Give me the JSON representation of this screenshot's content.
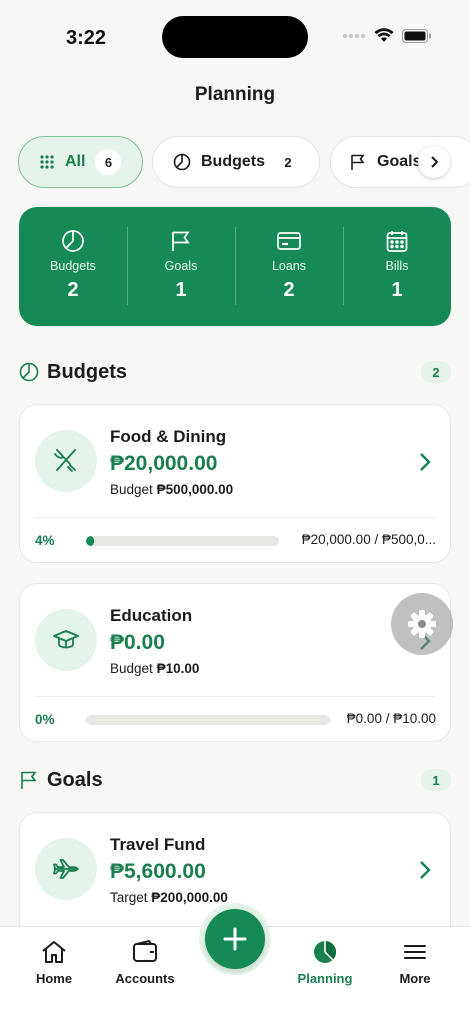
{
  "status_bar": {
    "time": "3:22"
  },
  "header": {
    "title": "Planning"
  },
  "filter_chips": [
    {
      "label": "All",
      "count": "6",
      "icon": "grid-icon",
      "active": true
    },
    {
      "label": "Budgets",
      "count": "2",
      "icon": "pie-chart-icon",
      "active": false
    },
    {
      "label": "Goals",
      "count": "",
      "icon": "flag-icon",
      "active": false
    }
  ],
  "summary": [
    {
      "label": "Budgets",
      "value": "2",
      "icon": "pie-chart-icon"
    },
    {
      "label": "Goals",
      "value": "1",
      "icon": "flag-icon"
    },
    {
      "label": "Loans",
      "value": "2",
      "icon": "card-icon"
    },
    {
      "label": "Bills",
      "value": "1",
      "icon": "calendar-icon"
    }
  ],
  "budgets_section": {
    "title": "Budgets",
    "count": "2",
    "items": [
      {
        "name": "Food & Dining",
        "amount": "₱20,000.00",
        "sub_label": "Budget",
        "sub_value": "₱500,000.00",
        "percent_label": "4%",
        "progress": 0.04,
        "ratio": "₱20,000.00 / ₱500,0...",
        "icon": "fork-knife-icon"
      },
      {
        "name": "Education",
        "amount": "₱0.00",
        "sub_label": "Budget",
        "sub_value": "₱10.00",
        "percent_label": "0%",
        "progress": 0,
        "ratio": "₱0.00 / ₱10.00",
        "icon": "graduation-cap-icon"
      }
    ]
  },
  "goals_section": {
    "title": "Goals",
    "count": "1",
    "items": [
      {
        "name": "Travel Fund",
        "amount": "₱5,600.00",
        "sub_label": "Target",
        "sub_value": "₱200,000.00",
        "icon": "airplane-icon"
      }
    ]
  },
  "tabbar": {
    "home": "Home",
    "accounts": "Accounts",
    "planning": "Planning",
    "more": "More"
  },
  "colors": {
    "accent": "#168a56",
    "accent_text": "#1a7f4f",
    "accent_light": "#e4f4ea"
  }
}
